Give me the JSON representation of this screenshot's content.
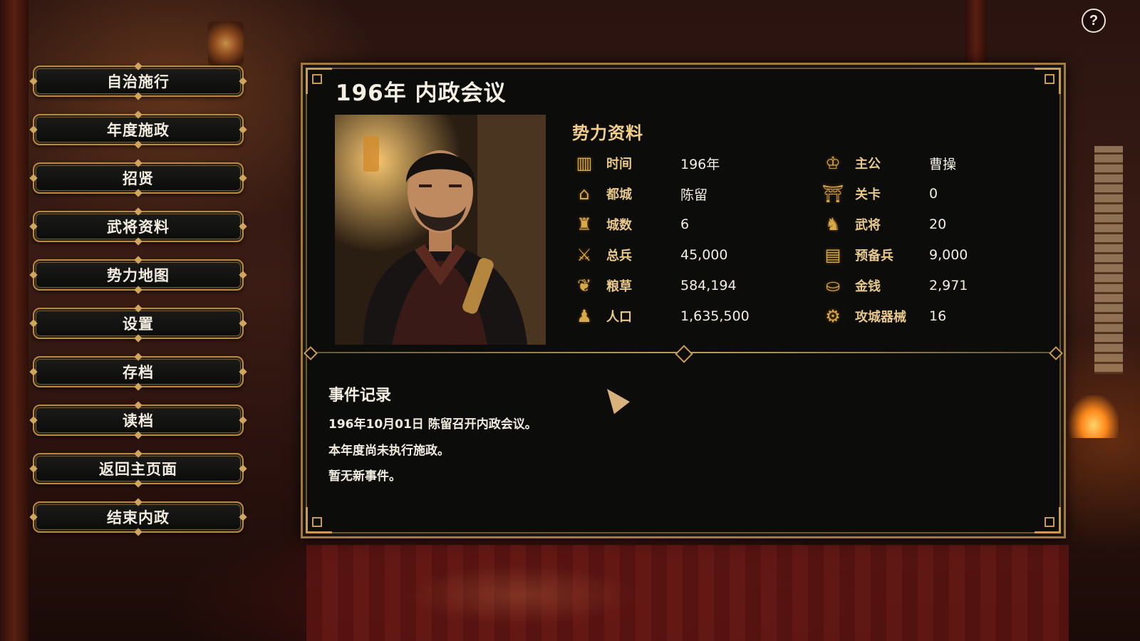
{
  "help": {
    "label": "?"
  },
  "menu": [
    {
      "label": "自治施行"
    },
    {
      "label": "年度施政"
    },
    {
      "label": "招贤"
    },
    {
      "label": "武将资料"
    },
    {
      "label": "势力地图"
    },
    {
      "label": "设置"
    },
    {
      "label": "存档"
    },
    {
      "label": "读档"
    },
    {
      "label": "返回主页面"
    },
    {
      "label": "结束内政"
    }
  ],
  "panel": {
    "title": "196年  内政会议"
  },
  "faction": {
    "title": "势力资料",
    "left": [
      {
        "label": "时间",
        "value": "196年",
        "icon": "bamboo-scroll-icon"
      },
      {
        "label": "都城",
        "value": "陈留",
        "icon": "palace-icon"
      },
      {
        "label": "城数",
        "value": "6",
        "icon": "castle-icon"
      },
      {
        "label": "总兵",
        "value": "45,000",
        "icon": "army-icon"
      },
      {
        "label": "粮草",
        "value": "584,194",
        "icon": "grain-sack-icon"
      },
      {
        "label": "人口",
        "value": "1,635,500",
        "icon": "people-icon"
      }
    ],
    "right": [
      {
        "label": "主公",
        "value": "曹操",
        "icon": "lord-icon"
      },
      {
        "label": "关卡",
        "value": "0",
        "icon": "fortress-gate-icon"
      },
      {
        "label": "武将",
        "value": "20",
        "icon": "general-icon"
      },
      {
        "label": "预备兵",
        "value": "9,000",
        "icon": "reserve-troops-icon"
      },
      {
        "label": "金钱",
        "value": "2,971",
        "icon": "gold-coins-icon"
      },
      {
        "label": "攻城器械",
        "value": "16",
        "icon": "siege-engine-icon"
      }
    ]
  },
  "events": {
    "title": "事件记录",
    "lines": [
      "196年10月01日    陈留召开内政会议。",
      "本年度尚未执行施政。",
      "暂无新事件。"
    ]
  }
}
